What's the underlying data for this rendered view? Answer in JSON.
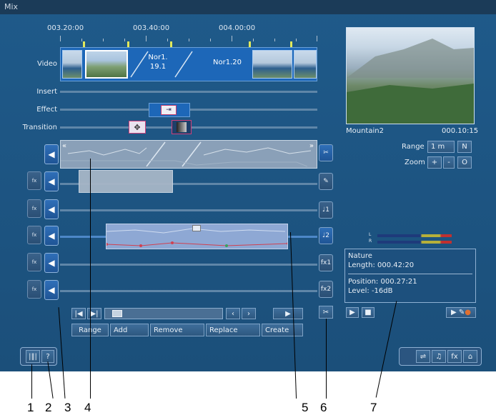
{
  "window": {
    "title": "Mix"
  },
  "ruler": {
    "timecodes": [
      "003.20:00",
      "003.40:00",
      "004.00:00"
    ]
  },
  "tracks": {
    "video_label": "Video",
    "insert_label": "Insert",
    "effect_label": "Effect",
    "transition_label": "Transition"
  },
  "video_clips": {
    "clip1_line1": "Nor1.",
    "clip1_line2": "19.1",
    "clip2": "Nor1.20"
  },
  "audio": {
    "fx_label": "fx",
    "tracks_count": 6,
    "right_icons": [
      "scissors-icon",
      "brush-icon",
      "music-note-1",
      "music-note-2",
      "fx1",
      "fx2"
    ],
    "right_labels": {
      "m1": "♩1",
      "m2": "♩2",
      "fx1": "fx1",
      "fx2": "fx2"
    }
  },
  "preview": {
    "clip_name": "Mountain2",
    "clip_time": "000.10:15",
    "range_label": "Range",
    "range_value": "1 m",
    "range_button": "N",
    "zoom_label": "Zoom",
    "zoom_plus": "+",
    "zoom_minus": "-",
    "zoom_o": "O"
  },
  "meters": {
    "left": "L",
    "right": "R"
  },
  "info": {
    "name": "Nature",
    "length": "Length: 000.42:20",
    "position": "Position: 000.27:21",
    "level": "Level: -16dB"
  },
  "buttons": {
    "range": "Range",
    "add": "Add",
    "remove": "Remove",
    "replace": "Replace",
    "create": "Create"
  },
  "callouts": [
    "1",
    "2",
    "3",
    "4",
    "5",
    "6",
    "7"
  ]
}
